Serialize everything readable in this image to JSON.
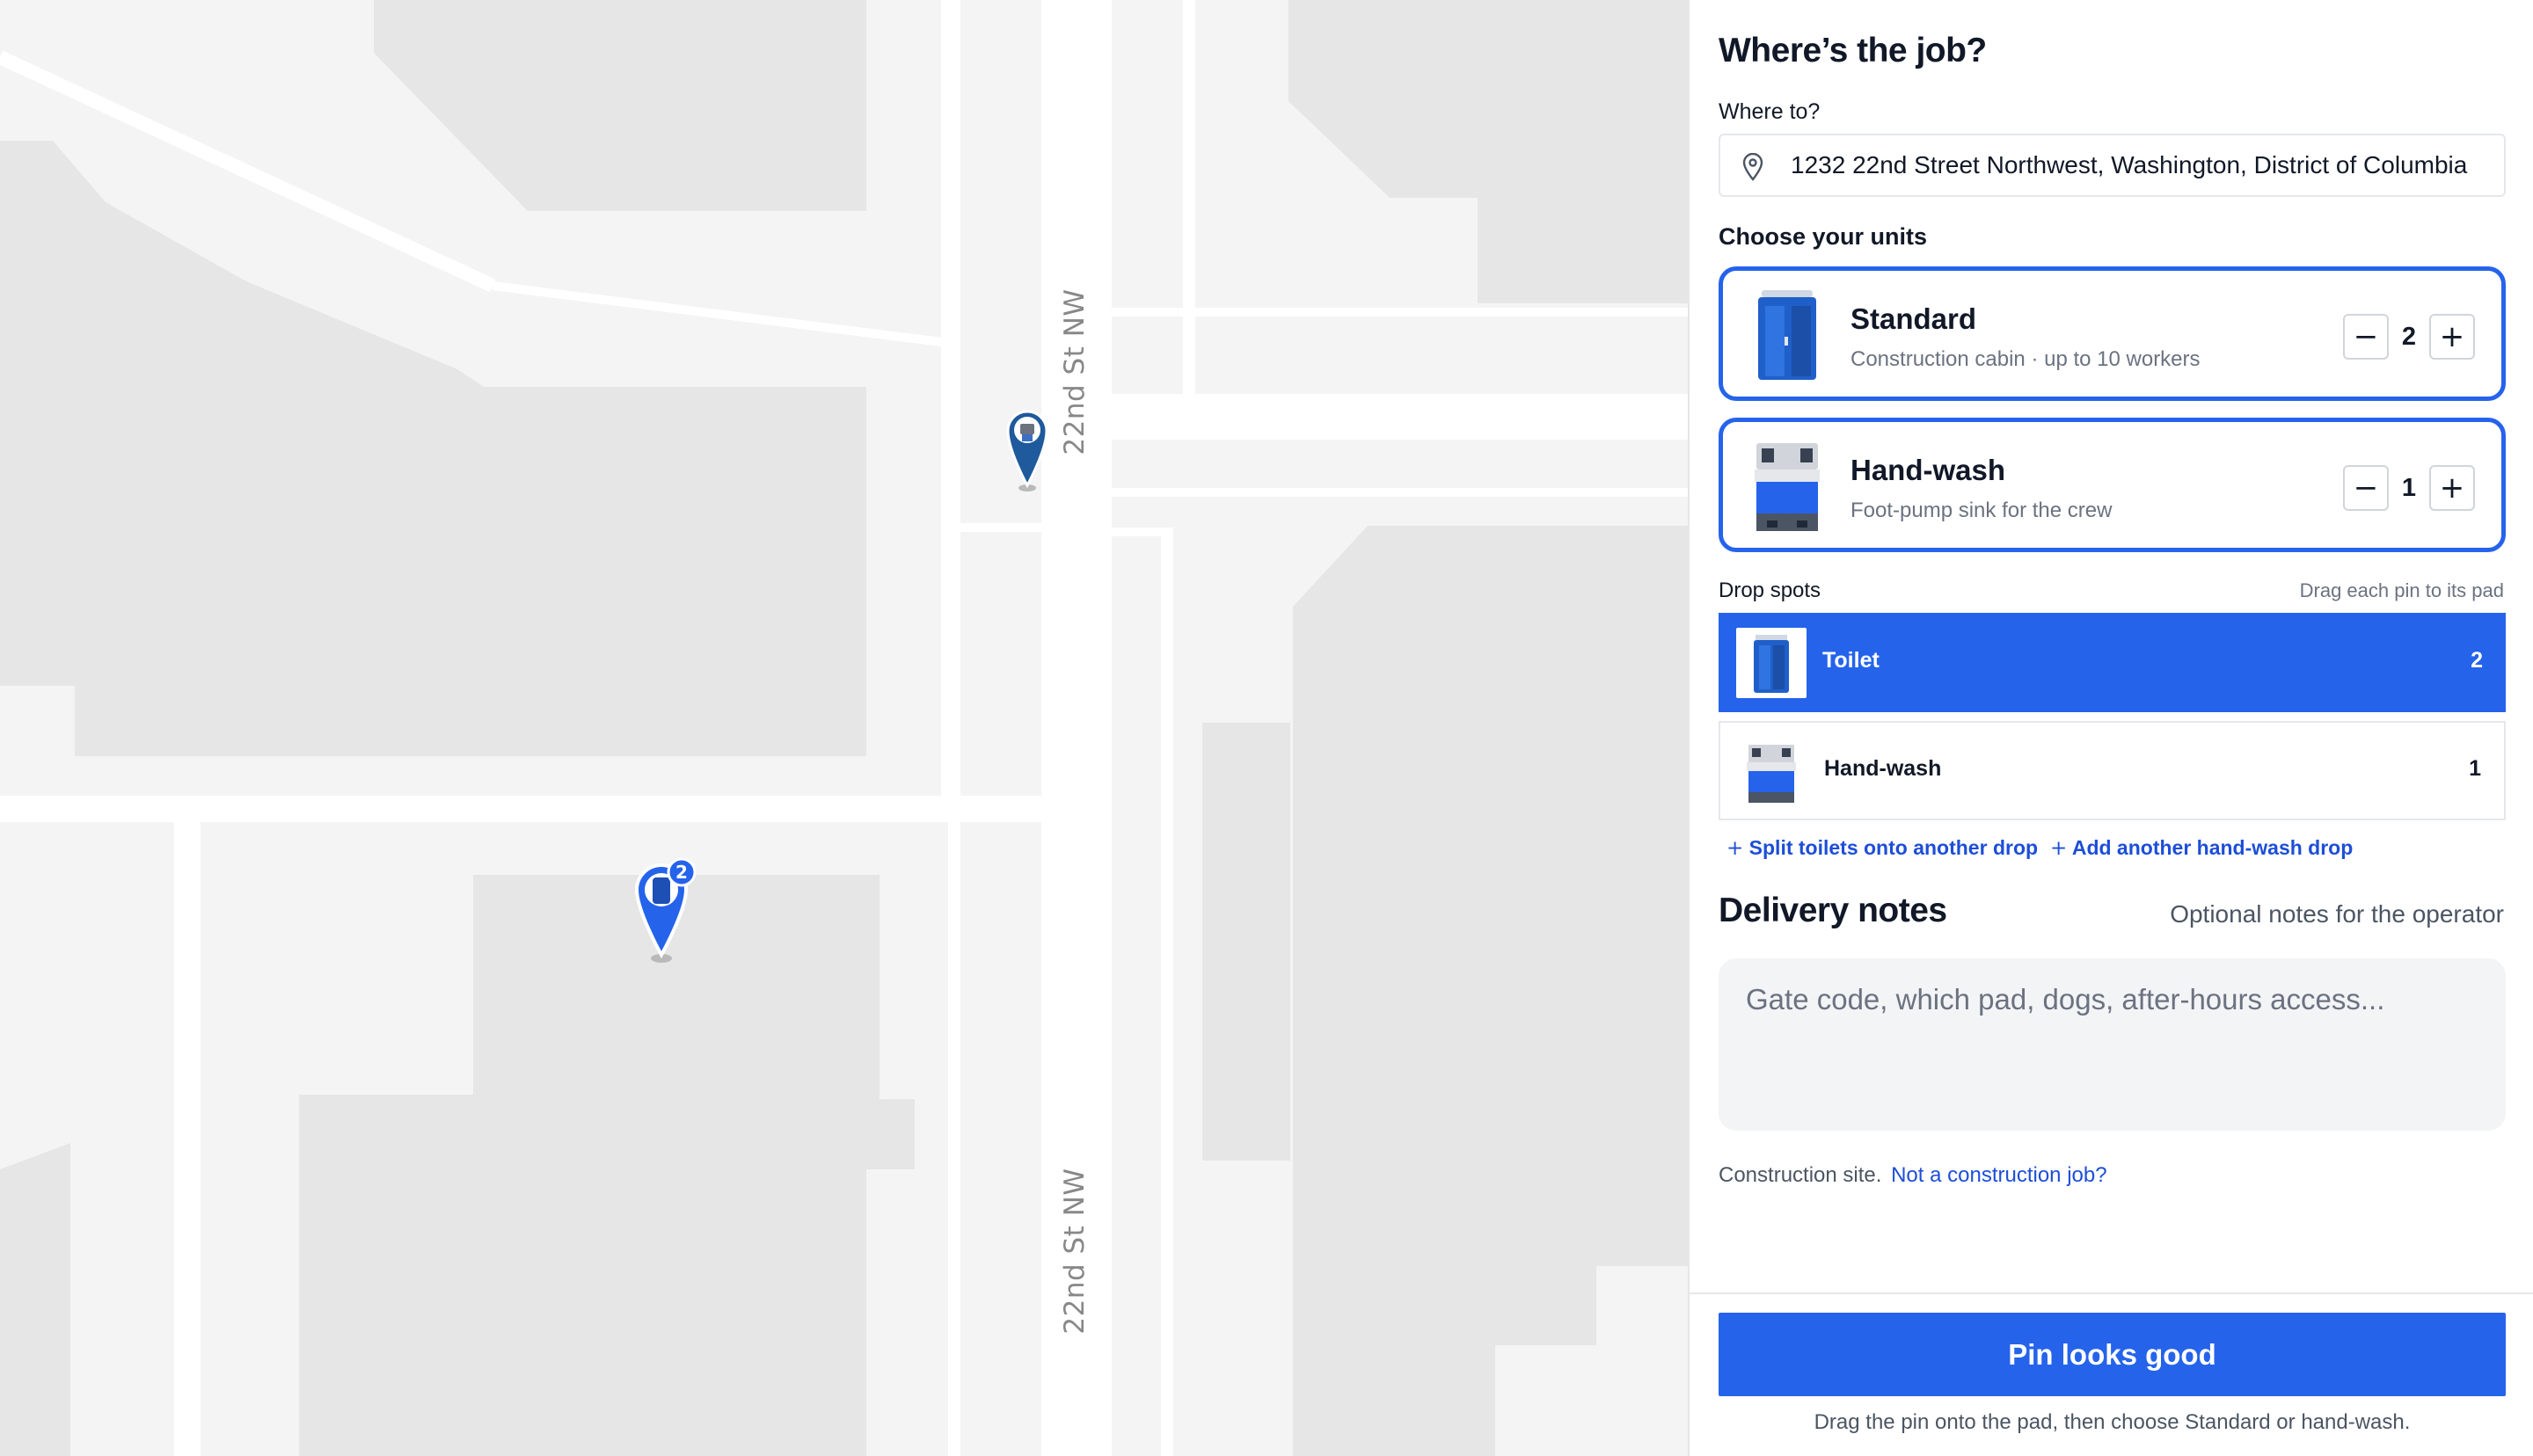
{
  "map": {
    "street_label_top": "22nd St NW",
    "street_label_bottom": "22nd St NW",
    "pins": [
      {
        "name": "hand-wash-pin",
        "icon": "hand-wash-icon",
        "color": "#1e5a9c"
      },
      {
        "name": "toilet-pin",
        "icon": "toilet-icon",
        "color": "#2563eb",
        "badge": "2"
      }
    ]
  },
  "panel": {
    "title": "Where’s the job?",
    "address": {
      "label": "Where to?",
      "value": "1232 22nd Street Northwest, Washington, District of Columbia",
      "icon": "location-pin-icon"
    },
    "units": {
      "heading": "Choose your units",
      "items": [
        {
          "name": "Standard",
          "description": "Construction cabin · up to 10 workers",
          "quantity": "2",
          "icon": "portable-toilet-icon"
        },
        {
          "name": "Hand-wash",
          "description": "Foot-pump sink for the crew",
          "quantity": "1",
          "icon": "hand-wash-station-icon"
        }
      ],
      "minus": "−",
      "plus": "+"
    },
    "drop_spots": {
      "heading": "Drop spots",
      "hint": "Drag each pin to its pad",
      "rows": [
        {
          "label": "Toilet",
          "count": "2",
          "selected": true
        },
        {
          "label": "Hand-wash",
          "count": "1",
          "selected": false
        }
      ],
      "split_link": "Split toilets onto another drop",
      "add_link": "Add another hand-wash drop",
      "link_icon": "+"
    },
    "notes": {
      "heading": "Delivery notes",
      "hint": "Optional notes for the operator",
      "placeholder": "Gate code, which pad, dogs, after-hours access..."
    },
    "site": {
      "text": "Construction site.",
      "link": "Not a construction job?"
    },
    "cta": "Pin looks good",
    "footer": "Drag the pin onto the pad, then choose Standard or hand-wash.",
    "colors": {
      "accent": "#2563eb",
      "pin_dark": "#1e5a9c"
    }
  }
}
